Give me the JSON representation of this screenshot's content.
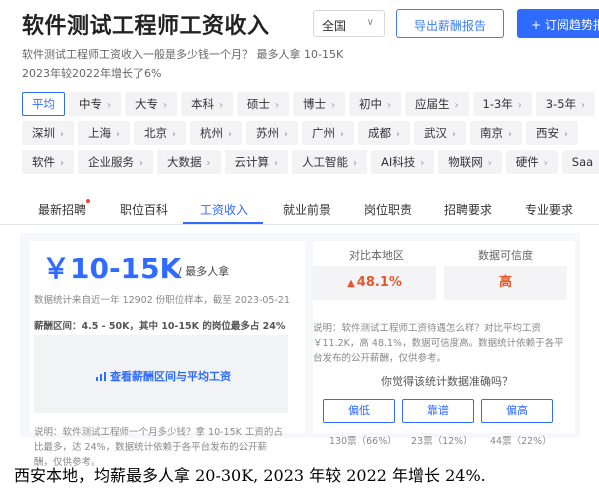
{
  "header": {
    "title": "软件测试工程师工资收入",
    "city_select": "全国",
    "export_button": "导出薪酬报告",
    "subscribe_button": "+ 订阅趋势报告"
  },
  "summary": {
    "line1": "软件测试工程师工资收入一般是多少钱一个月？ 最多人拿 10-15K",
    "line2": "2023年较2022年增长了6%"
  },
  "tag_rows": [
    [
      "平均",
      "中专",
      "大专",
      "本科",
      "硕士",
      "博士",
      "初中",
      "应届生",
      "1-3年",
      "3-5年"
    ],
    [
      "深圳",
      "上海",
      "北京",
      "杭州",
      "苏州",
      "广州",
      "成都",
      "武汉",
      "南京",
      "西安"
    ],
    [
      "软件",
      "企业服务",
      "大数据",
      "云计算",
      "人工智能",
      "AI科技",
      "物联网",
      "硬件",
      "Saa"
    ]
  ],
  "tag_arrow": "›",
  "tabs": [
    "最新招聘",
    "职位百科",
    "工资收入",
    "就业前景",
    "岗位职责",
    "招聘要求",
    "专业要求"
  ],
  "salary": {
    "value": "￥10-15K",
    "suffix": "/ 最多人拿",
    "note": "数据统计来自近一年 12902 份职位样本，截至 2023-05-21",
    "range_note": "薪酬区间：4.5 - 50K，其中 10-15K 的岗位最多占 24%",
    "view_link": "查看薪酬区间与平均工资",
    "description": "说明：软件测试工程师一个月多少钱？拿 10-15K 工资的占比最多，达 24%，数据统计依赖于各平台发布的公开薪酬，仅供参考。"
  },
  "compare": {
    "label_local": "对比本地区",
    "label_reliability": "数据可信度",
    "local_value": "48.1%",
    "reliability_value": "高",
    "description": "说明：软件测试工程师工资待遇怎么样？对比平均工资￥11.2K，高 48.1%，数据可信度高。数据统计依赖于各平台发布的公开薪酬，仅供参考。",
    "question": "你觉得该统计数据准确吗？",
    "votes": [
      {
        "label": "偏低",
        "count": "130票（66%）"
      },
      {
        "label": "靠谱",
        "count": "23票（12%）"
      },
      {
        "label": "偏高",
        "count": "44票（22%）"
      }
    ]
  },
  "caption": "西安本地，均薪最多人拿  20-30K, 2023 年较 2022 年增长 24%.",
  "colors": {
    "accent": "#2f6bff",
    "highlight": "#e8562a",
    "new_dot": "#ff3b30"
  }
}
